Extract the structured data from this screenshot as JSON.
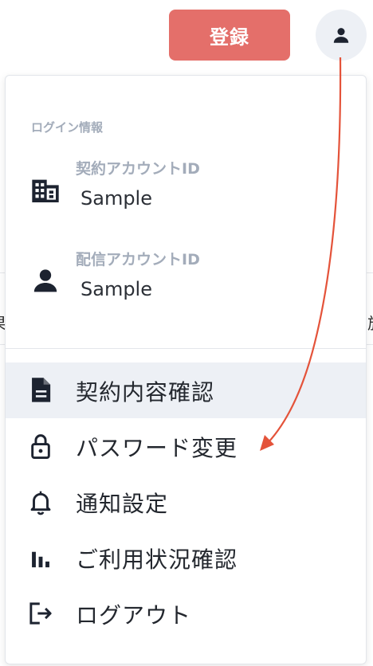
{
  "header": {
    "register_label": "登録",
    "avatar_icon": "user-icon"
  },
  "background": {
    "left_fragment": "果",
    "right_fragment": "於"
  },
  "menu": {
    "section_title": "ログイン情報",
    "accounts": [
      {
        "label": "契約アカウントID",
        "value": "Sample",
        "icon": "building-icon"
      },
      {
        "label": "配信アカウントID",
        "value": "Sample",
        "icon": "user-icon"
      }
    ],
    "items": [
      {
        "label": "契約内容確認",
        "icon": "document-icon",
        "active": true
      },
      {
        "label": "パスワード変更",
        "icon": "lock-icon",
        "active": false
      },
      {
        "label": "通知設定",
        "icon": "bell-icon",
        "active": false
      },
      {
        "label": "ご利用状況確認",
        "icon": "bar-chart-icon",
        "active": false
      },
      {
        "label": "ログアウト",
        "icon": "logout-icon",
        "active": false
      }
    ]
  },
  "colors": {
    "register_button": "#e46f6a",
    "annotation_arrow": "#e4533a",
    "active_item_bg": "#edf0f5",
    "muted_label": "#a3acba"
  }
}
